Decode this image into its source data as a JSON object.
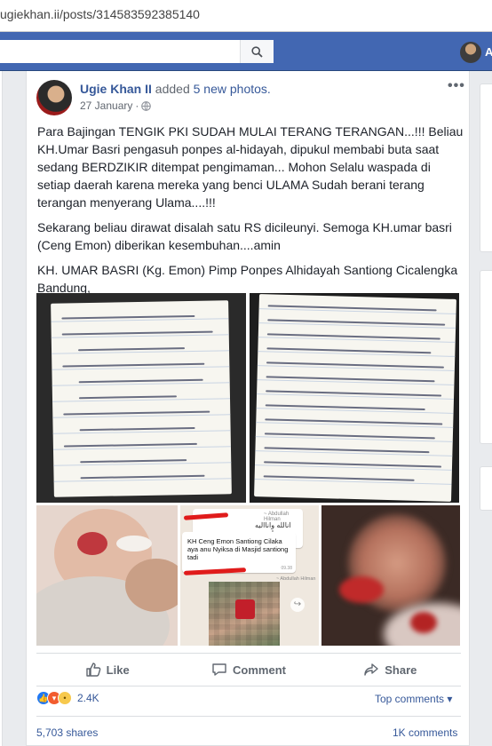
{
  "browser": {
    "url": "ugiekhan.ii/posts/314583592385140"
  },
  "nav": {
    "profile_name": "A"
  },
  "post": {
    "author": "Ugie Khan II",
    "action_text": "added",
    "photos_link": "5 new photos.",
    "date": "27 January",
    "more_glyph": "•••",
    "paragraphs": [
      "Para Bajingan TENGIK PKI SUDAH MULAI TERANG TERANGAN...!!! Beliau KH.Umar Basri pengasuh ponpes al-hidayah, dipukul membabi buta saat sedang BERDZIKIR ditempat pengimaman... Mohon Selalu waspada di setiap daerah karena mereka yang benci ULAMA Sudah berani terang terangan menyerang Ulama....!!!",
      "Sekarang beliau dirawat disalah satu RS dicileunyi. Semoga KH.umar basri (Ceng Emon) diberikan kesembuhan....amin",
      "KH. UMAR BASRI (Kg. Emon) Pimp Ponpes Alhidayah Santiong Cicalengka Bandung,"
    ]
  },
  "chat_photo": {
    "sender_top": "~ Abdullah Hilman",
    "arabic": "انالله وانااليه راجعون",
    "message": "KH Ceng Emon Santiong  Cilaka aya anu Nyiksa di Masjid santiong tadi",
    "time": "09.38",
    "sender_bottom": "~ Abdullah Hilman"
  },
  "actions": {
    "like": "Like",
    "comment": "Comment",
    "share": "Share"
  },
  "stats": {
    "reaction_count": "2.4K",
    "top_comments": "Top comments",
    "shares": "5,703 shares",
    "comments": "1K comments"
  },
  "colors": {
    "fb_blue": "#4267b2",
    "link": "#365899",
    "text": "#1d2129",
    "muted": "#616770"
  }
}
